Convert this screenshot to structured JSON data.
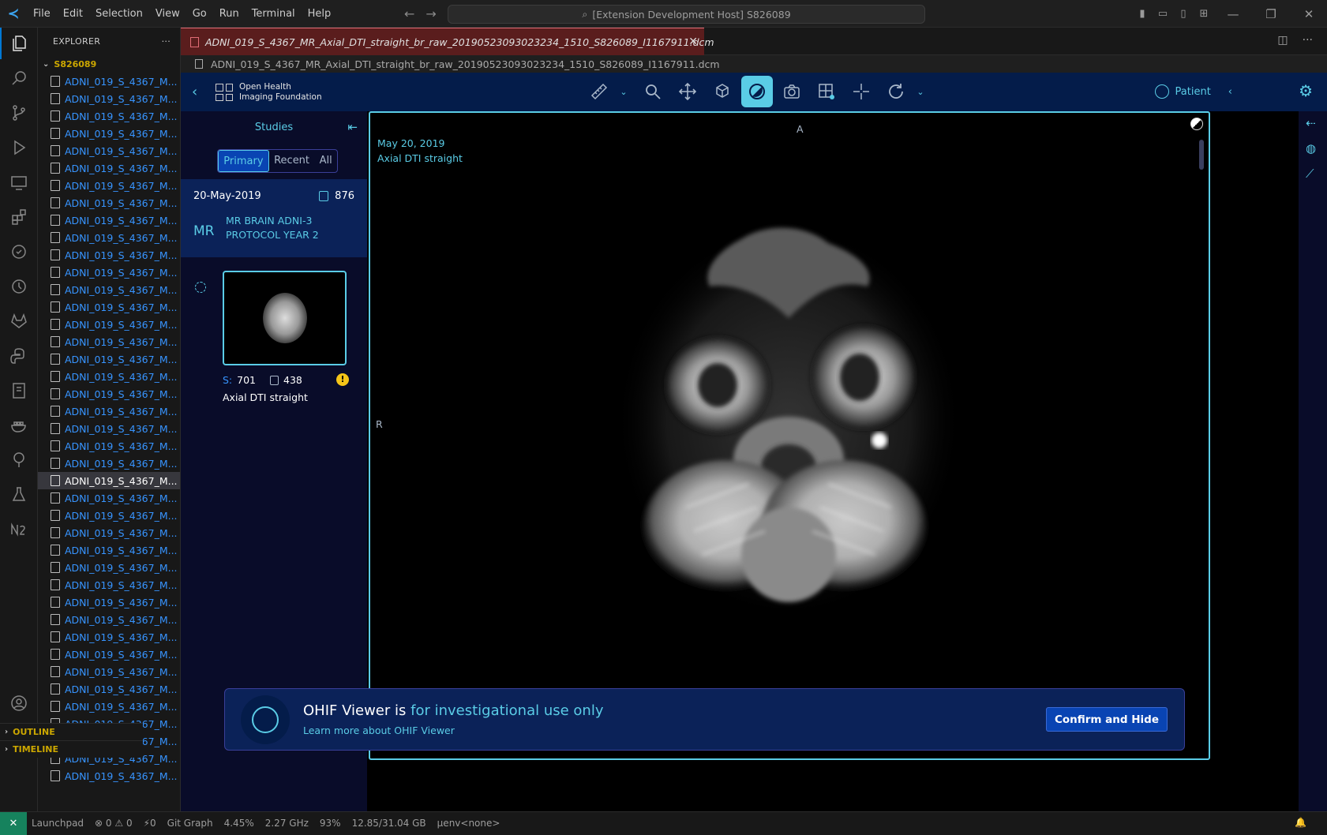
{
  "titlebar": {
    "menu": [
      "File",
      "Edit",
      "Selection",
      "View",
      "Go",
      "Run",
      "Terminal",
      "Help"
    ],
    "command_center": "[Extension Development Host] S826089"
  },
  "explorer": {
    "header": "EXPLORER",
    "more": "···",
    "folder": "S826089",
    "files": [
      "ADNI_019_S_4367_M...",
      "ADNI_019_S_4367_M...",
      "ADNI_019_S_4367_M...",
      "ADNI_019_S_4367_M...",
      "ADNI_019_S_4367_M...",
      "ADNI_019_S_4367_M...",
      "ADNI_019_S_4367_M...",
      "ADNI_019_S_4367_M...",
      "ADNI_019_S_4367_M...",
      "ADNI_019_S_4367_M...",
      "ADNI_019_S_4367_M...",
      "ADNI_019_S_4367_M...",
      "ADNI_019_S_4367_M...",
      "ADNI_019_S_4367_M...",
      "ADNI_019_S_4367_M...",
      "ADNI_019_S_4367_M...",
      "ADNI_019_S_4367_M...",
      "ADNI_019_S_4367_M...",
      "ADNI_019_S_4367_M...",
      "ADNI_019_S_4367_M...",
      "ADNI_019_S_4367_M...",
      "ADNI_019_S_4367_M...",
      "ADNI_019_S_4367_M...",
      "ADNI_019_S_4367_M...",
      "ADNI_019_S_4367_M...",
      "ADNI_019_S_4367_M...",
      "ADNI_019_S_4367_M...",
      "ADNI_019_S_4367_M...",
      "ADNI_019_S_4367_M...",
      "ADNI_019_S_4367_M...",
      "ADNI_019_S_4367_M...",
      "ADNI_019_S_4367_M...",
      "ADNI_019_S_4367_M...",
      "ADNI_019_S_4367_M...",
      "ADNI_019_S_4367_M...",
      "ADNI_019_S_4367_M...",
      "ADNI_019_S_4367_M...",
      "ADNI_019_S_4367_M...",
      "ADNI_019_S_4367_M...",
      "ADNI_019_S_4367_M...",
      "ADNI_019_S_4367_M..."
    ],
    "selected_index": 23,
    "outline": "OUTLINE",
    "timeline": "TIMELINE"
  },
  "editor": {
    "tab_title": "ADNI_019_S_4367_MR_Axial_DTI_straight_br_raw_20190523093023234_1510_S826089_I1167911.dcm",
    "breadcrumb": "ADNI_019_S_4367_MR_Axial_DTI_straight_br_raw_20190523093023234_1510_S826089_I1167911.dcm"
  },
  "ohif": {
    "logo_line1": "Open Health",
    "logo_line2": "Imaging Foundation",
    "patient_label": "Patient",
    "studies_title": "Studies",
    "filter_tabs": [
      "Primary",
      "Recent",
      "All"
    ],
    "active_filter": "Primary",
    "study": {
      "date": "20-May-2019",
      "instance_count": "876",
      "modality": "MR",
      "description_line1": "MR BRAIN ADNI-3",
      "description_line2": "PROTOCOL YEAR 2"
    },
    "series": {
      "number_prefix": "S:",
      "number": "701",
      "instances": "438",
      "name": "Axial DTI straight"
    },
    "viewport": {
      "date": "May 20, 2019",
      "series": "Axial DTI straight",
      "orientation_top": "A",
      "orientation_left": "R"
    },
    "notice": {
      "text_prefix": "OHIF Viewer is ",
      "text_highlight": "for investigational use only",
      "link": "Learn more about OHIF Viewer",
      "button": "Confirm and Hide"
    }
  },
  "statusbar": {
    "remote": "✕",
    "launchpad": "Launchpad",
    "problems": "⊗ 0 ⚠ 0",
    "ports": "⚡0",
    "git_graph": "Git Graph",
    "cpu": "4.45%",
    "freq": "2.27 GHz",
    "mem_pct": "93%",
    "mem": "12.85/31.04 GB",
    "env": "µenv<none>"
  }
}
